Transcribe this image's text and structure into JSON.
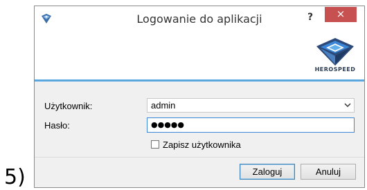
{
  "page_label": "5)",
  "window": {
    "title": "Logowanie do aplikacji",
    "help_label": "?",
    "close_label": "×",
    "app_icon": "app-diamond-icon"
  },
  "banner": {
    "logo_text": "HEROSPEED",
    "accent_color": "#5aa6de"
  },
  "form": {
    "user_label": "Użytkownik:",
    "user_value": "admin",
    "password_label": "Hasło:",
    "password_masked": "●●●●●",
    "remember_label": "Zapisz użytkownika",
    "remember_checked": false
  },
  "buttons": {
    "login_label": "Zaloguj",
    "cancel_label": "Anuluj"
  }
}
